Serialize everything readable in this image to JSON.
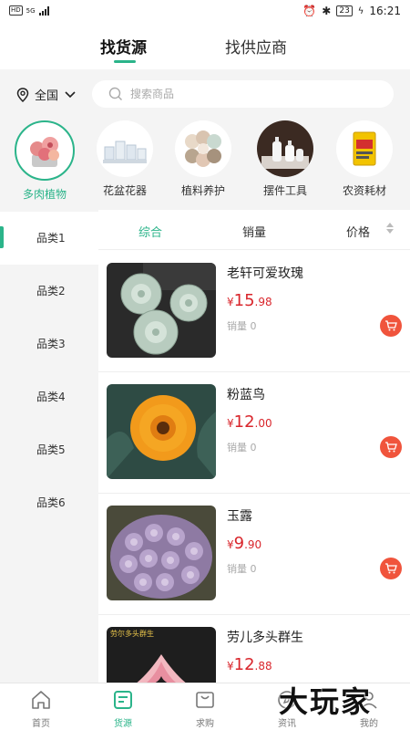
{
  "status_bar": {
    "network": "HD",
    "signal": "5G",
    "battery": "23",
    "time": "16:21"
  },
  "top_tabs": [
    {
      "label": "找货源",
      "active": true
    },
    {
      "label": "找供应商",
      "active": false
    }
  ],
  "location": {
    "label": "全国"
  },
  "search": {
    "placeholder": "搜索商品"
  },
  "categories": [
    {
      "label": "多肉植物",
      "active": true,
      "icon": "succulent-icon"
    },
    {
      "label": "花盆花器",
      "active": false,
      "icon": "flowerpot-icon"
    },
    {
      "label": "植料养护",
      "active": false,
      "icon": "soil-icon"
    },
    {
      "label": "摆件工具",
      "active": false,
      "icon": "tool-icon"
    },
    {
      "label": "农资耗材",
      "active": false,
      "icon": "fertilizer-icon"
    }
  ],
  "sidebar": {
    "items": [
      {
        "label": "品类1",
        "active": true
      },
      {
        "label": "品类2",
        "active": false
      },
      {
        "label": "品类3",
        "active": false
      },
      {
        "label": "品类4",
        "active": false
      },
      {
        "label": "品类5",
        "active": false
      },
      {
        "label": "品类6",
        "active": false
      }
    ]
  },
  "sort": {
    "overall": "综合",
    "sales": "销量",
    "price": "价格"
  },
  "products": [
    {
      "name": "老轩可爱玫瑰",
      "currency": "¥",
      "price_int": "15",
      "price_dec": ".98",
      "sales": "销量 0"
    },
    {
      "name": "粉蓝鸟",
      "currency": "¥",
      "price_int": "12",
      "price_dec": ".00",
      "sales": "销量 0"
    },
    {
      "name": "玉露",
      "currency": "¥",
      "price_int": "9",
      "price_dec": ".90",
      "sales": "销量 0"
    },
    {
      "name": "劳儿多头群生",
      "currency": "¥",
      "price_int": "12",
      "price_dec": ".88",
      "sales": "",
      "image_caption": "劳尔多头群生"
    }
  ],
  "bottom_nav": [
    {
      "label": "首页",
      "active": false
    },
    {
      "label": "货源",
      "active": true
    },
    {
      "label": "求购",
      "active": false
    },
    {
      "label": "资讯",
      "active": false
    },
    {
      "label": "我的",
      "active": false
    }
  ],
  "watermark": "大玩家",
  "colors": {
    "accent": "#2bb48a",
    "price": "#d9262c",
    "cart": "#f0543c"
  }
}
